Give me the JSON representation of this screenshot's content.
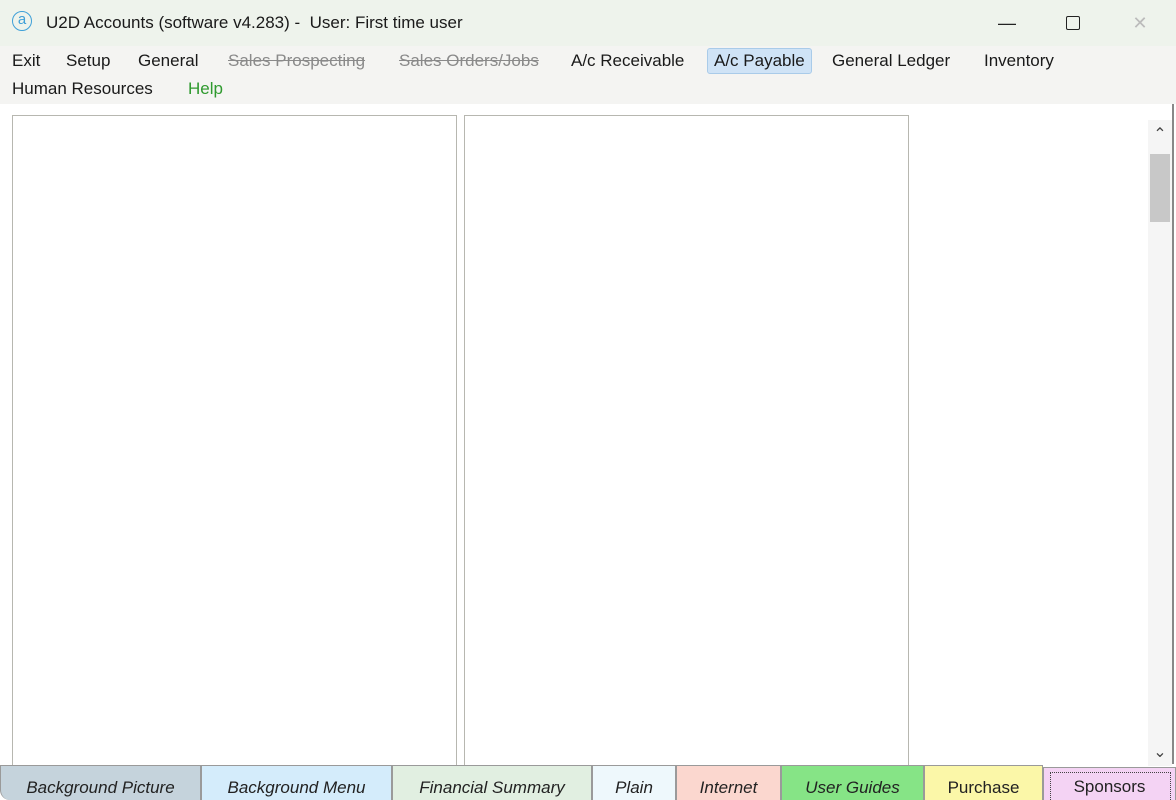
{
  "window": {
    "app_icon": "a",
    "title": "U2D Accounts (software v4.283) -  User: First time user",
    "controls": {
      "minimize": "—",
      "maximize": "",
      "close": "✕"
    }
  },
  "menu": {
    "items": [
      {
        "label": "Exit",
        "state": "normal"
      },
      {
        "label": "Setup",
        "state": "normal"
      },
      {
        "label": "General",
        "state": "normal"
      },
      {
        "label": "Sales Prospecting",
        "state": "disabled"
      },
      {
        "label": "Sales Orders/Jobs",
        "state": "disabled"
      },
      {
        "label": "A/c Receivable",
        "state": "normal"
      },
      {
        "label": "A/c Payable",
        "state": "selected"
      },
      {
        "label": "General Ledger",
        "state": "normal"
      },
      {
        "label": "Inventory",
        "state": "normal"
      },
      {
        "label": "Human Resources",
        "state": "normal"
      },
      {
        "label": "Help",
        "state": "help"
      }
    ]
  },
  "scrollbar": {
    "up": "⌃",
    "down": "⌄"
  },
  "tabs": [
    {
      "label": "Background Picture",
      "color": "#c5d3dc"
    },
    {
      "label": "Background Menu",
      "color": "#d4ecfb"
    },
    {
      "label": "Financial Summary",
      "color": "#e1efe1"
    },
    {
      "label": "Plain",
      "color": "#eef8fc"
    },
    {
      "label": "Internet",
      "color": "#fbd7cf"
    },
    {
      "label": "User Guides",
      "color": "#86e486"
    },
    {
      "label": "Purchase",
      "color": "#fbf7a8"
    },
    {
      "label": "Sponsors",
      "color": "#f4d3f4",
      "selected": true
    }
  ]
}
